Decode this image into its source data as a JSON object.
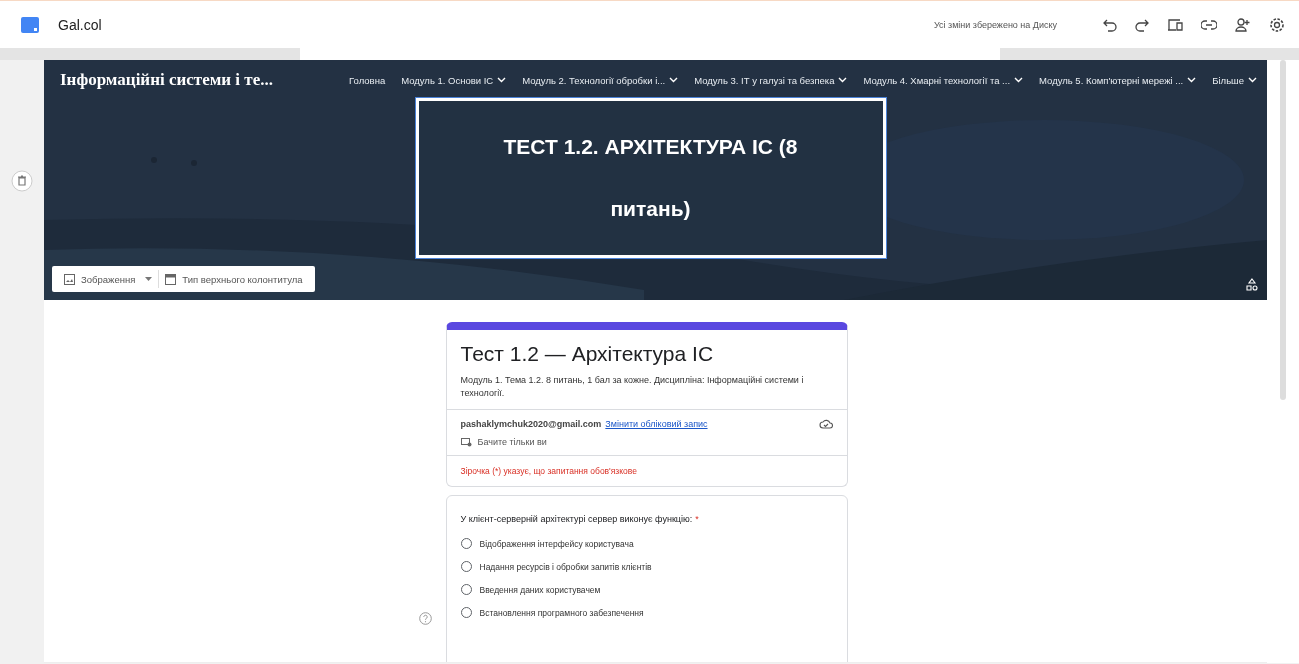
{
  "app": {
    "title": "Gal.col",
    "save_status": "Усі зміни збережено на Диску"
  },
  "site": {
    "title": "Інформаційні системи і те...",
    "nav": [
      {
        "label": "Головна",
        "dropdown": false
      },
      {
        "label": "Модуль 1. Основи ІС",
        "dropdown": true
      },
      {
        "label": "Модуль 2. Технології обробки і...",
        "dropdown": true
      },
      {
        "label": "Модуль 3. ІТ у галузі та безпека",
        "dropdown": true
      },
      {
        "label": "Модуль 4. Хмарні технології та ...",
        "dropdown": true
      },
      {
        "label": "Модуль 5. Комп'ютерні мережі ...",
        "dropdown": true
      },
      {
        "label": "Більше",
        "dropdown": true
      }
    ],
    "banner_title": "ТЕСТ 1.2. АРХІТЕКТУРА ІС (8 питань)",
    "tools": [
      "Зображення",
      "Тип верхнього колонтитула"
    ]
  },
  "form": {
    "title": "Тест 1.2 — Архітектура ІС",
    "description": "Модуль 1. Тема 1.2. 8 питань, 1 бал за кожне. Дисципліна: Інформаційні системи і технології.",
    "email": "pashaklymchuk2020@gmail.com",
    "switch_account": "Змінити обліковий запис",
    "visibility": "Бачите тільки ви",
    "required_note": "Зірочка (*) указує, що запитання обов'язкове"
  },
  "question": {
    "text": "У клієнт-серверній архітектурі сервер виконує функцію:",
    "required": true,
    "required_mark": "*",
    "options": [
      {
        "label": "Відображення інтерфейсу користувача",
        "selected": false
      },
      {
        "label": "Надання ресурсів і обробки запитів клієнтів",
        "selected": false
      },
      {
        "label": "Введення даних користувачем",
        "selected": false
      },
      {
        "label": "Встановлення програмного забезпечення",
        "selected": false
      }
    ]
  }
}
